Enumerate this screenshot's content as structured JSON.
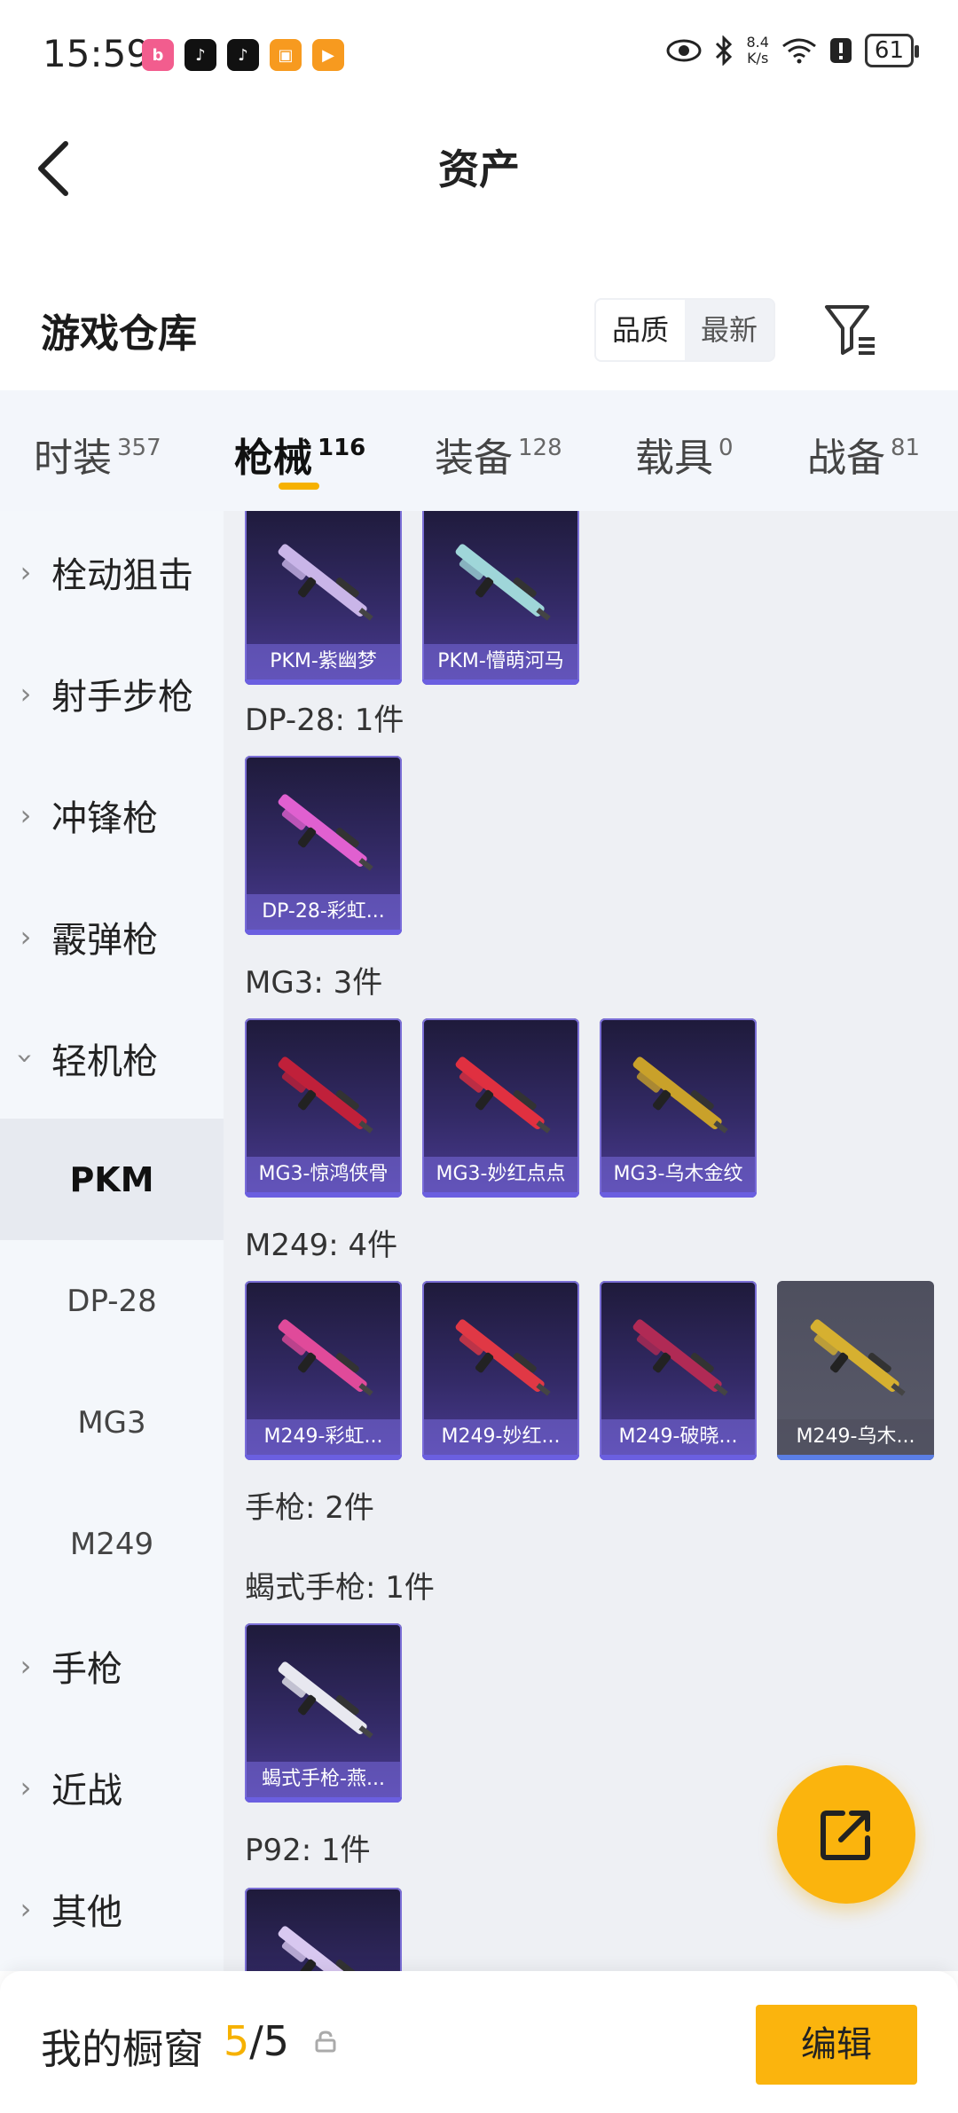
{
  "status_bar": {
    "time": "15:59",
    "net_speed_value": "8.4",
    "net_speed_unit": "K/s",
    "battery": "61",
    "app_icons": [
      {
        "name": "bilibili-icon",
        "color": "#f25d8e",
        "glyph": "b"
      },
      {
        "name": "tiktok-icon",
        "color": "#111111",
        "glyph": "♪"
      },
      {
        "name": "tiktok-icon-2",
        "color": "#111111",
        "glyph": "♪"
      },
      {
        "name": "game-controller-icon",
        "color": "#f79a1f",
        "glyph": "▣"
      },
      {
        "name": "play-icon",
        "color": "#f79a1f",
        "glyph": "▶"
      }
    ]
  },
  "header": {
    "title": "资产"
  },
  "warehouse": {
    "title": "游戏仓库",
    "sort_options": [
      "品质",
      "最新"
    ],
    "sort_active": "品质"
  },
  "tabs": [
    {
      "label": "时装",
      "count": "357"
    },
    {
      "label": "枪械",
      "count": "116",
      "active": true
    },
    {
      "label": "装备",
      "count": "128"
    },
    {
      "label": "载具",
      "count": "0"
    },
    {
      "label": "战备",
      "count": "81"
    }
  ],
  "sidebar": {
    "categories": [
      {
        "label": "栓动狙击"
      },
      {
        "label": "射手步枪"
      },
      {
        "label": "冲锋枪"
      },
      {
        "label": "霰弹枪"
      },
      {
        "label": "轻机枪",
        "expanded": true
      },
      {
        "label": "手枪"
      },
      {
        "label": "近战"
      },
      {
        "label": "其他"
      }
    ],
    "subitems": [
      {
        "label": "PKM",
        "active": true
      },
      {
        "label": "DP-28"
      },
      {
        "label": "MG3"
      },
      {
        "label": "M249"
      }
    ]
  },
  "content": {
    "groups": [
      {
        "label": "DP-28: 1件"
      },
      {
        "label": "MG3: 3件"
      },
      {
        "label": "M249: 4件"
      },
      {
        "label": "手枪: 2件"
      },
      {
        "label": "蝎式手枪: 1件"
      },
      {
        "label": "P92: 1件"
      }
    ],
    "items": [
      {
        "name": "PKM-紫幽梦",
        "gun_color": "#c9b5e8"
      },
      {
        "name": "PKM-懵萌河马",
        "gun_color": "#9fd6d9"
      },
      {
        "name": "DP-28-彩虹...",
        "gun_color": "#e060d0"
      },
      {
        "name": "MG3-惊鸿侠骨",
        "gun_color": "#c0203a"
      },
      {
        "name": "MG3-妙红点点",
        "gun_color": "#e03040"
      },
      {
        "name": "MG3-乌木金纹",
        "gun_color": "#c9a12a"
      },
      {
        "name": "M249-彩虹...",
        "gun_color": "#e04a9a"
      },
      {
        "name": "M249-妙红...",
        "gun_color": "#e03845"
      },
      {
        "name": "M249-破晓...",
        "gun_color": "#b02a55"
      },
      {
        "name": "M249-乌木...",
        "gun_color": "#d6b030"
      },
      {
        "name": "蝎式手枪-燕...",
        "gun_color": "#e8e8f0"
      },
      {
        "name": "",
        "gun_color": "#d8c8f0"
      }
    ]
  },
  "bottom_bar": {
    "label": "我的橱窗",
    "count_current": "5",
    "count_sep": "/",
    "count_total": "5",
    "edit_label": "编辑"
  }
}
